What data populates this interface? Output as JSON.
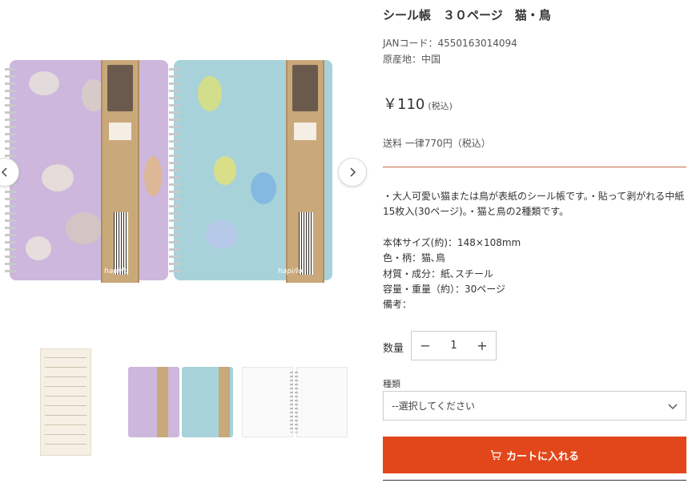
{
  "product": {
    "title": "シール帳　３０ページ　猫・鳥",
    "jan": "JANコード：4550163014094",
    "origin": "原産地：中国",
    "price": "￥110",
    "tax_note": "(税込)",
    "shipping": "送料 一律770円（税込）",
    "description": "・大人可愛い猫または鳥が表紙のシール帳です。・貼って剥がれる中紙15枚入(30ページ)。・猫と鳥の2種類です。",
    "specs": [
      "本体サイズ(約)：148×108mm",
      "色・柄：猫､鳥",
      "材質・成分：紙､スチール",
      "容量・重量（約）：30ページ",
      "備考："
    ]
  },
  "quantity": {
    "label": "数量",
    "value": "1",
    "minus": "−",
    "plus": "+"
  },
  "variant": {
    "label": "種類",
    "selected": "--選択してください"
  },
  "cart": {
    "label": "カートに入れる"
  },
  "image": {
    "brand": "hapi/lo",
    "band_text": "Sticker Collecting Book"
  },
  "colors": {
    "accent": "#e2471b",
    "divider": "#c9694a",
    "book_purple": "#cdb7dc",
    "book_blue": "#a8d2d9"
  },
  "icons": {
    "prev": "chevron-left-icon",
    "next": "chevron-right-icon",
    "dropdown": "chevron-down-icon",
    "cart": "cart-icon"
  }
}
